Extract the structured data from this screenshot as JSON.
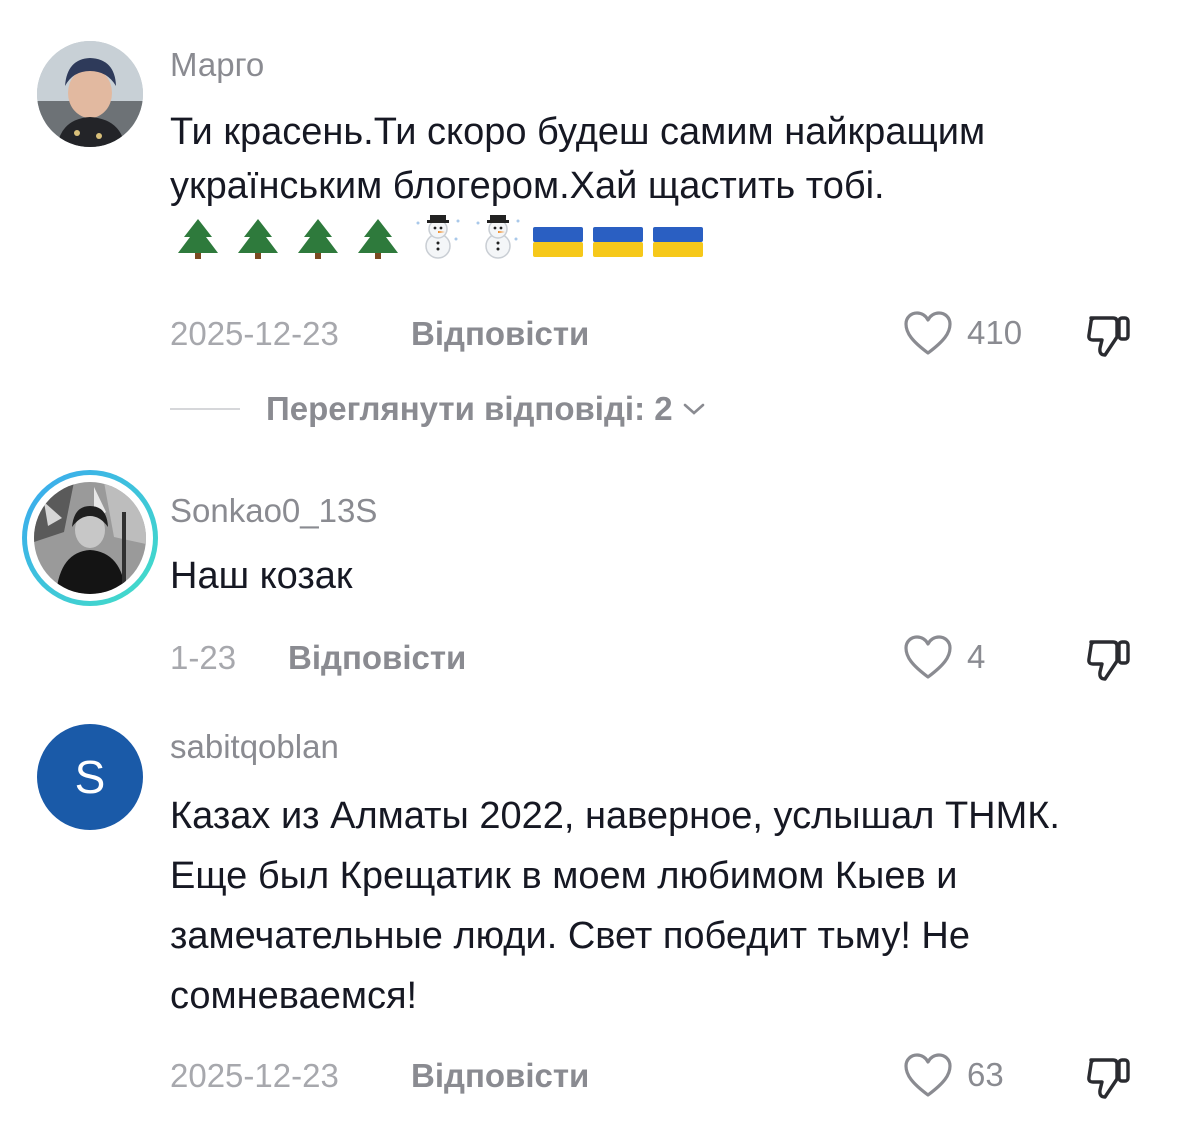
{
  "comments": [
    {
      "username": "Марго",
      "text": "Ти красень.Ти скоро будеш самим найкращим українським блогером.Хай щастить тобі.",
      "emojis": [
        "christmas-tree-icon",
        "christmas-tree-icon",
        "christmas-tree-icon",
        "christmas-tree-icon",
        "snowman-icon",
        "snowman-icon",
        "ukraine-flag-icon",
        "ukraine-flag-icon",
        "ukraine-flag-icon"
      ],
      "date": "2025-12-23",
      "reply_label": "Відповісти",
      "likes": "410"
    },
    {
      "username": "Sonkao0_13S",
      "text": "Наш козак",
      "date": "1-23",
      "reply_label": "Відповісти",
      "likes": "4"
    },
    {
      "username": "sabitqoblan",
      "avatar_letter": "S",
      "text": "Казах из Алматы 2022, наверное, услышал ТНМК. Еще был Крещатик в моем любимом Кыев и замечательные люди. Свет победит тьму! Не сомневаемся!",
      "date": "2025-12-23",
      "reply_label": "Відповісти",
      "likes": "63"
    }
  ],
  "view_replies": "Переглянути відповіді: 2",
  "colors": {
    "avatar_blue": "#1a5aa8",
    "story_ring_start": "#43e0c6",
    "story_ring_end": "#3aa7f0",
    "flag_blue": "#2a5fc2",
    "flag_yellow": "#f6c81a"
  }
}
